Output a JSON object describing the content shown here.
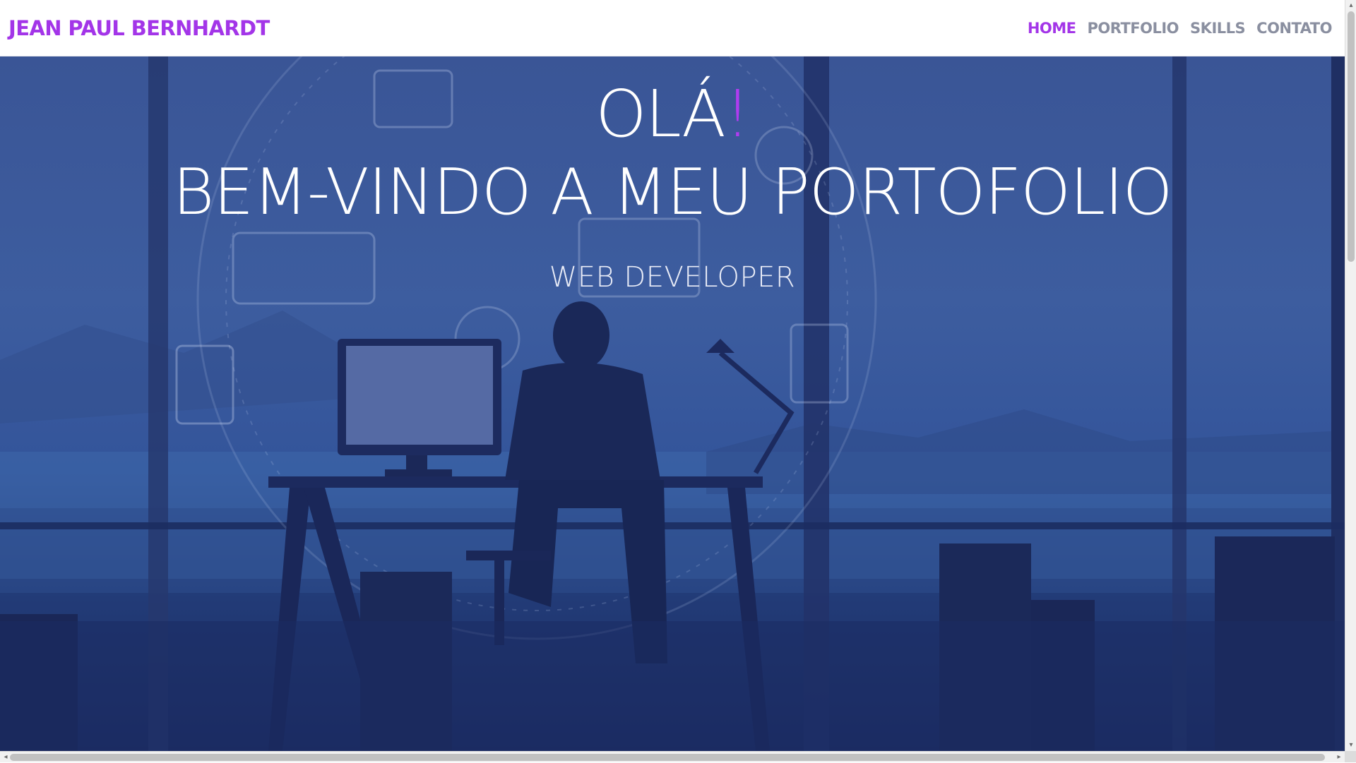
{
  "brand": {
    "name": "JEAN PAUL BERNHARDT"
  },
  "nav": {
    "home": "HOME",
    "portfolio": "PORTFOLIO",
    "skills": "SKILLS",
    "contact": "CONTATO"
  },
  "hero": {
    "greeting": "OLÁ",
    "greeting_mark": "!",
    "welcome": "BEM-VINDO A MEU PORTOFOLIO",
    "role": "WEB DEVELOPER",
    "background_image": "developer-silhouette-at-desk"
  },
  "colors": {
    "accent": "#a335e8",
    "nav_inactive": "#8a8fa0",
    "hero_overlay": "#2f4f95"
  },
  "icons": {
    "scroll_up": "▴",
    "scroll_down": "▾",
    "scroll_left": "◂",
    "scroll_right": "▸"
  }
}
